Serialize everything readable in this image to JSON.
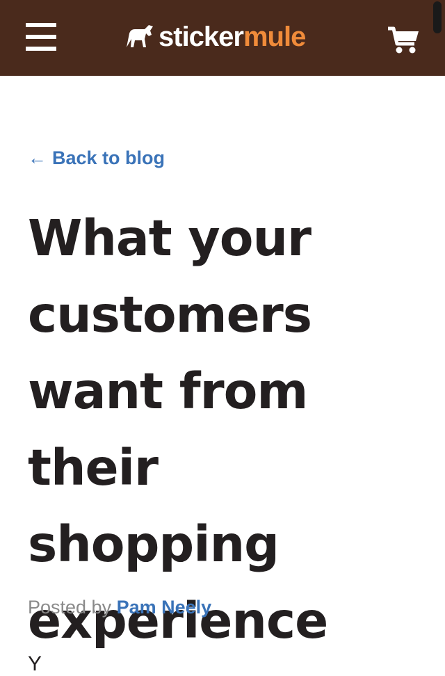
{
  "header": {
    "logo_part1": "sticker",
    "logo_part2": "mule",
    "bg_color": "#4a2a1c",
    "accent_color": "#f08b3a",
    "menu_icon": "hamburger-menu-icon",
    "cart_icon": "shopping-cart-icon"
  },
  "article": {
    "back_arrow": "←",
    "back_label": "Back to blog",
    "title": "What your customers want from their shopping experience",
    "byline_prefix": "Posted by",
    "author": "Pam Neely",
    "body_start": "Y"
  },
  "colors": {
    "link": "#3a73b8",
    "title": "#231f20",
    "byline": "#8a8a8a"
  }
}
